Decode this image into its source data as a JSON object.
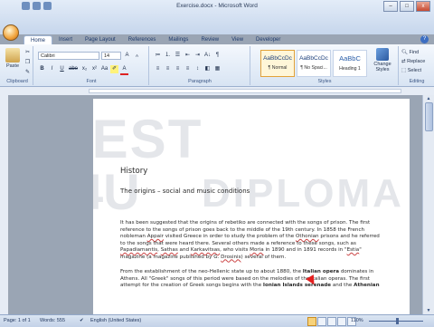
{
  "window": {
    "title": "Exercise.docx - Microsoft Word",
    "minimize": "–",
    "maximize": "□",
    "close": "x"
  },
  "tabs": [
    "Home",
    "Insert",
    "Page Layout",
    "References",
    "Mailings",
    "Review",
    "View",
    "Developer"
  ],
  "help": "?",
  "ribbon": {
    "clipboard": {
      "label": "Clipboard",
      "paste": "Paste"
    },
    "font": {
      "label": "Font",
      "name": "Calibri",
      "size": "14",
      "bold": "B",
      "italic": "I",
      "underline": "U",
      "strike": "abe",
      "sub": "x₂",
      "sup": "x²",
      "aa": "Aa",
      "color_a": "A",
      "grow": "A",
      "shrink": "A"
    },
    "paragraph": {
      "label": "Paragraph",
      "sort": "A↓",
      "pilcrow": "¶"
    },
    "styles": {
      "label": "Styles",
      "items": [
        {
          "sample": "AaBbCcDc",
          "name": "¶ Normal"
        },
        {
          "sample": "AaBbCcDc",
          "name": "¶ No Spaci..."
        },
        {
          "sample": "AaBbC",
          "name": "Heading 1"
        }
      ],
      "change": "Change Styles"
    },
    "editing": {
      "label": "Editing",
      "find": "Find",
      "replace": "Replace",
      "select": "Select"
    }
  },
  "watermark": {
    "line1": "TEST",
    "line2": "4U",
    "line3": "DIPLOMA"
  },
  "document": {
    "heading": "History",
    "subheading": "The origins – social and music conditions",
    "para1": [
      {
        "t": "It has been suggested that the origins of rebetiko are connected with the songs of prison. The first reference to the songs of prison goes back to the middle of the 19th century. In 1858 the French nobleman ",
        "s": ""
      },
      {
        "t": "Appair",
        "s": "u"
      },
      {
        "t": " visited Greece in order to study the problem of the ",
        "s": ""
      },
      {
        "t": "Othonian",
        "s": "u"
      },
      {
        "t": " prisons and he referred to the songs that were heard there. Several others made a reference to these songs, such as ",
        "s": ""
      },
      {
        "t": "Papadiamantis",
        "s": "u"
      },
      {
        "t": ", ",
        "s": ""
      },
      {
        "t": "Sathas",
        "s": "u"
      },
      {
        "t": " and ",
        "s": ""
      },
      {
        "t": "Karkavitsas",
        "s": "u"
      },
      {
        "t": ", who visits ",
        "s": ""
      },
      {
        "t": "Moria",
        "s": "u"
      },
      {
        "t": " in 1890 and in 1891 records in \"",
        "s": ""
      },
      {
        "t": "Estia",
        "s": "u"
      },
      {
        "t": "\" magazine (a magazine published by G. ",
        "s": ""
      },
      {
        "t": "Drosinis",
        "s": "u"
      },
      {
        "t": ") several of them.",
        "s": ""
      }
    ],
    "para2": [
      {
        "t": "From the establishment of the neo-Hellenic state up to about 1880, the ",
        "s": ""
      },
      {
        "t": "Italian opera",
        "s": "b"
      },
      {
        "t": " dominates in Athens. All \"Greek\" songs of this period were based on the melodies of the Italian operas. The first attempt for the creation of Greek songs begins with the ",
        "s": ""
      },
      {
        "t": "Ionian Islands serenade",
        "s": "b"
      },
      {
        "t": " and the ",
        "s": ""
      },
      {
        "t": "Athenian",
        "s": "b"
      }
    ]
  },
  "status": {
    "page": "Page: 1 of 1",
    "words": "Words: 555",
    "language": "English (United States)",
    "zoom": "110%",
    "zoom_level": 1.1
  },
  "colors": {
    "accent": "#2b579a",
    "cursor": "#e41f1f"
  }
}
